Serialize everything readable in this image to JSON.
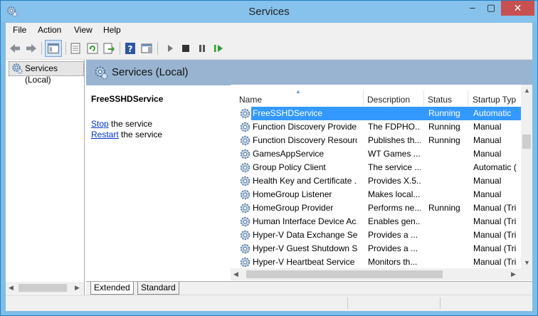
{
  "window": {
    "title": "Services",
    "minimize": "–",
    "maximize": "▢",
    "close": "✕"
  },
  "menu": [
    "File",
    "Action",
    "View",
    "Help"
  ],
  "toolbar": {
    "icons": [
      "back-arrow-icon",
      "forward-arrow-icon",
      "show-hide-console-tree-icon",
      "properties-icon",
      "refresh-icon",
      "export-list-icon",
      "help-icon",
      "show-action-pane-icon",
      "start-service-icon",
      "stop-service-icon",
      "pause-service-icon",
      "restart-service-icon"
    ]
  },
  "tree": {
    "item": "Services (Local)"
  },
  "header": {
    "title": "Services (Local)"
  },
  "description": {
    "service_name": "FreeSSHDService",
    "stop_link": "Stop",
    "stop_rest": " the service",
    "restart_link": "Restart",
    "restart_rest": " the service"
  },
  "columns": {
    "name": "Name",
    "description": "Description",
    "status": "Status",
    "startup": "Startup Typ"
  },
  "rows": [
    {
      "name": "FreeSSHDService",
      "desc": "",
      "status": "Running",
      "startup": "Automatic",
      "selected": true
    },
    {
      "name": "Function Discovery Provide...",
      "desc": "The FDPHO...",
      "status": "Running",
      "startup": "Manual"
    },
    {
      "name": "Function Discovery Resourc...",
      "desc": "Publishes th...",
      "status": "Running",
      "startup": "Manual"
    },
    {
      "name": "GamesAppService",
      "desc": "WT Games ...",
      "status": "",
      "startup": "Manual"
    },
    {
      "name": "Group Policy Client",
      "desc": "The service ...",
      "status": "",
      "startup": "Automatic ("
    },
    {
      "name": "Health Key and Certificate ...",
      "desc": "Provides X.5...",
      "status": "",
      "startup": "Manual"
    },
    {
      "name": "HomeGroup Listener",
      "desc": "Makes local...",
      "status": "",
      "startup": "Manual"
    },
    {
      "name": "HomeGroup Provider",
      "desc": "Performs ne...",
      "status": "Running",
      "startup": "Manual (Tri"
    },
    {
      "name": "Human Interface Device Ac...",
      "desc": "Enables gen...",
      "status": "",
      "startup": "Manual (Tri"
    },
    {
      "name": "Hyper-V Data Exchange Ser...",
      "desc": "Provides a ...",
      "status": "",
      "startup": "Manual (Tri"
    },
    {
      "name": "Hyper-V Guest Shutdown S...",
      "desc": "Provides a ...",
      "status": "",
      "startup": "Manual (Tri"
    },
    {
      "name": "Hyper-V Heartbeat Service",
      "desc": "Monitors th...",
      "status": "",
      "startup": "Manual (Tri"
    }
  ],
  "tabs": [
    "Extended",
    "Standard"
  ],
  "colors": {
    "title_bar": "#86c2ec",
    "header_band": "#99b4d1",
    "selection": "#3399ff",
    "close_button": "#c75050",
    "link": "#0033cc"
  }
}
